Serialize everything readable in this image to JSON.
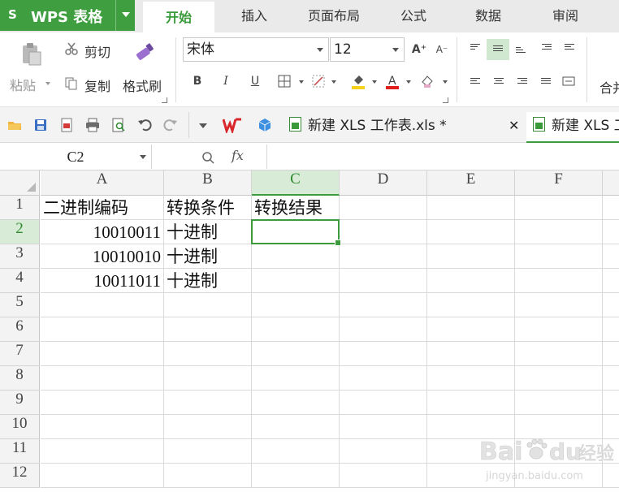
{
  "app": {
    "title": "WPS 表格",
    "logo": "S"
  },
  "ribbon_tabs": [
    {
      "label": "开始",
      "active": true
    },
    {
      "label": "插入",
      "active": false
    },
    {
      "label": "页面布局",
      "active": false
    },
    {
      "label": "公式",
      "active": false
    },
    {
      "label": "数据",
      "active": false
    },
    {
      "label": "审阅",
      "active": false
    }
  ],
  "clipboard": {
    "paste": "粘贴",
    "cut": "剪切",
    "copy": "复制",
    "format_painter": "格式刷"
  },
  "font": {
    "name": "宋体",
    "size": "12",
    "grow": "A⁺",
    "shrink": "A⁻",
    "bold": "B",
    "italic": "I",
    "underline": "U"
  },
  "merge": {
    "label": "合并"
  },
  "doc_tabs": [
    {
      "label": "新建 XLS 工作表.xls *",
      "active": false
    },
    {
      "label": "新建 XLS 工",
      "active": true
    }
  ],
  "formula_bar": {
    "name_box": "C2",
    "fx": "fx",
    "zoom_icon": "🔍"
  },
  "columns": [
    "A",
    "B",
    "C",
    "D",
    "E",
    "F"
  ],
  "rows": [
    "1",
    "2",
    "3",
    "4",
    "5",
    "6",
    "7",
    "8",
    "9",
    "10",
    "11",
    "12"
  ],
  "cells": {
    "A1": "二进制编码",
    "B1": "转换条件",
    "C1": "转换结果",
    "A2": "10010011",
    "B2": "十进制",
    "A3": "10010010",
    "B3": "十进制",
    "A4": "10011011",
    "B4": "十进制"
  },
  "selected_cell": "C2",
  "colors": {
    "accent": "#3f9e3f",
    "selection": "#3d9b3d",
    "header_sel_bg": "#d7ebd7"
  },
  "watermark": {
    "brand": "Bai",
    "brand2": "du",
    "suffix": "经验",
    "url": "jingyan.baidu.com"
  }
}
